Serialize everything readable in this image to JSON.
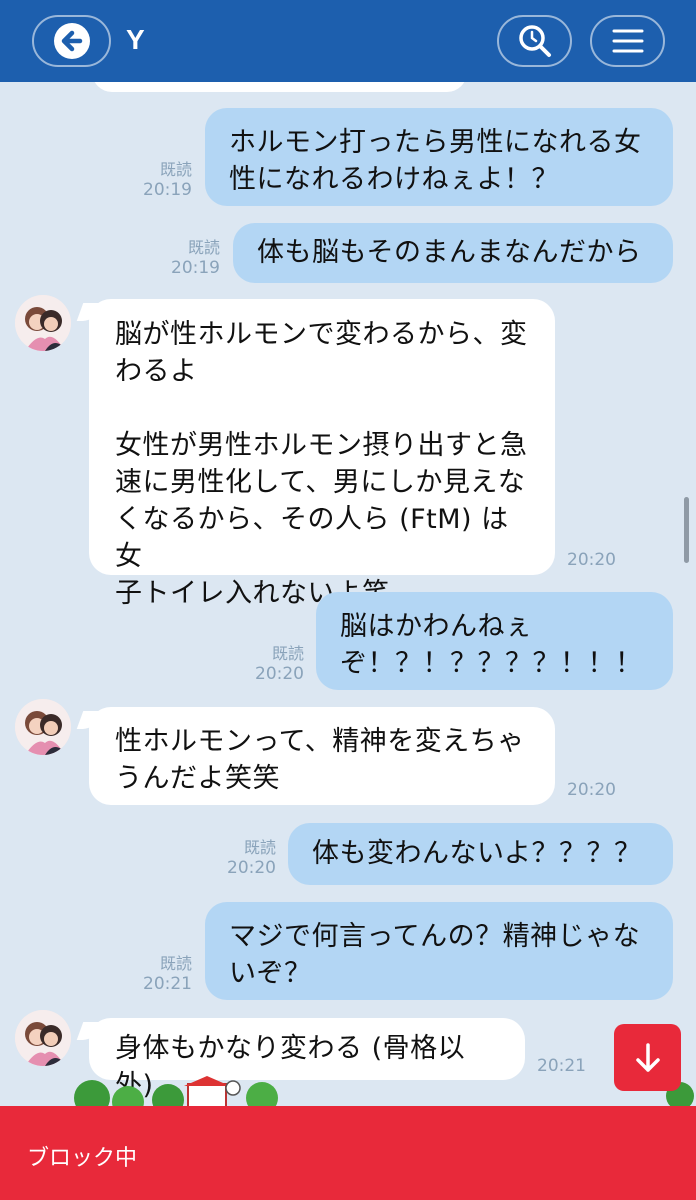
{
  "header": {
    "title": "Y",
    "bg_color": "#1d5fae",
    "icons": [
      "back-arrow-icon",
      "search-icon",
      "menu-icon"
    ]
  },
  "messages": [
    {
      "dir": "out",
      "text": "ホルモン打ったら男性になれる女\n性になれるわけねぇよ！？",
      "read": "既読",
      "time": "20:19"
    },
    {
      "dir": "out",
      "text": "体も脳もそのまんまなんだから",
      "read": "既読",
      "time": "20:19"
    },
    {
      "dir": "in",
      "text": "脳が性ホルモンで変わるから、変\nわるよ\n\n女性が男性ホルモン摂り出すと急\n速に男性化して、男にしか見えな\nくなるから、その人ら (FtM) は女\n子トイレ入れないよ笑",
      "time": "20:20"
    },
    {
      "dir": "out",
      "text": "脳はかわんねぇ\nぞ！？！？？？？！！！",
      "read": "既読",
      "time": "20:20"
    },
    {
      "dir": "in",
      "text": "性ホルモンって、精神を変えちゃ\nうんだよ笑笑",
      "time": "20:20"
    },
    {
      "dir": "out",
      "text": "体も変わんないよ？？？？",
      "read": "既読",
      "time": "20:20"
    },
    {
      "dir": "out",
      "text": "マジで何言ってんの？精神じゃな\nいぞ？",
      "read": "既読",
      "time": "20:21"
    },
    {
      "dir": "in",
      "text": "身体もかなり変わる (骨格以外)",
      "time": "20:21"
    }
  ],
  "footer": {
    "label": "ブロック中",
    "bg_color": "#e8293a"
  },
  "scroll_down_icon": "arrow-down-icon",
  "colors": {
    "outgoing_bubble": "#b3d6f4",
    "incoming_bubble": "#ffffff",
    "chat_bg": "#dce7f2"
  }
}
